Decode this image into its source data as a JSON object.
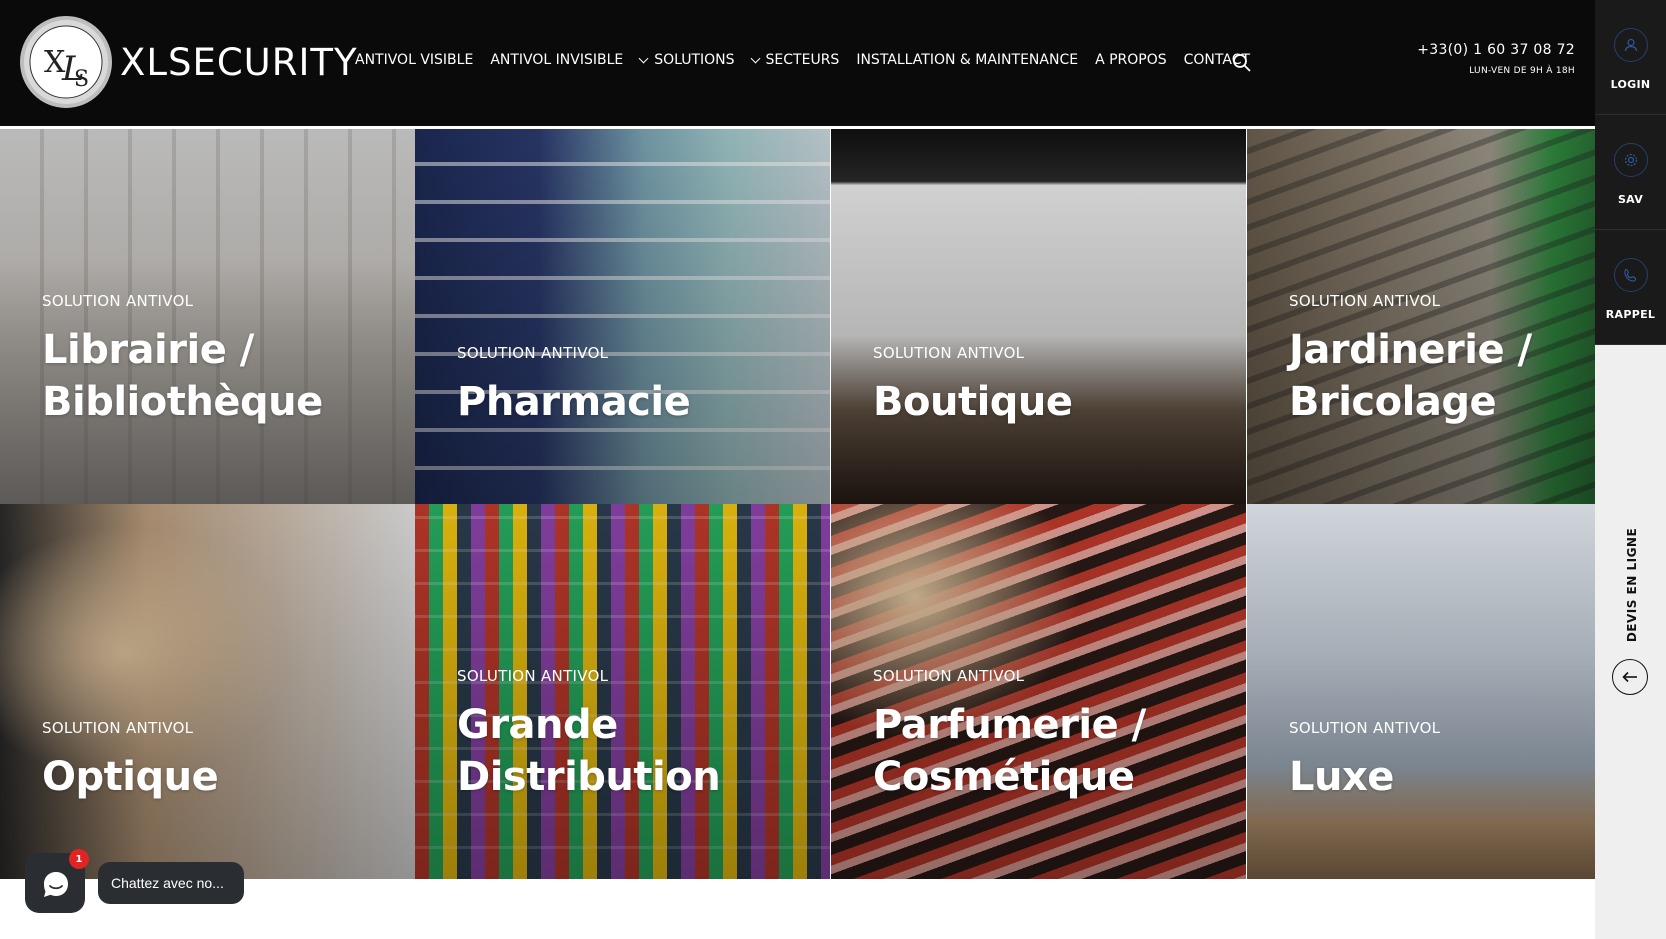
{
  "brand": {
    "name": "XLSECURITY",
    "monogram": "XLS"
  },
  "nav": {
    "items": [
      {
        "label": "ANTIVOL VISIBLE",
        "dropdown": false
      },
      {
        "label": "ANTIVOL INVISIBLE",
        "dropdown": false
      },
      {
        "label": "SOLUTIONS",
        "dropdown": true
      },
      {
        "label": "SECTEURS",
        "dropdown": true
      },
      {
        "label": "INSTALLATION & MAINTENANCE",
        "dropdown": false
      },
      {
        "label": "A PROPOS",
        "dropdown": false
      },
      {
        "label": "CONTACT",
        "dropdown": false
      }
    ],
    "search_icon": "search-icon"
  },
  "contact": {
    "phone": "+33(0) 1 60 37 08 72",
    "hours": "LUN-VEN DE 9H À 18H"
  },
  "sidebar": {
    "buttons": [
      {
        "label": "LOGIN",
        "icon": "user-icon"
      },
      {
        "label": "SAV",
        "icon": "gear-icon"
      },
      {
        "label": "RAPPEL",
        "icon": "phone-icon"
      }
    ],
    "devis_label": "DEVIS EN LIGNE",
    "toggle_icon": "arrow-left-icon"
  },
  "tiles": [
    {
      "kicker": "SOLUTION ANTIVOL",
      "title_lines": [
        "Librairie /",
        "Bibliothèque"
      ]
    },
    {
      "kicker": "SOLUTION ANTIVOL",
      "title_lines": [
        "Pharmacie"
      ]
    },
    {
      "kicker": "SOLUTION ANTIVOL",
      "title_lines": [
        "Boutique"
      ]
    },
    {
      "kicker": "SOLUTION ANTIVOL",
      "title_lines": [
        "Jardinerie /",
        "Bricolage"
      ]
    },
    {
      "kicker": "SOLUTION ANTIVOL",
      "title_lines": [
        "Optique"
      ]
    },
    {
      "kicker": "SOLUTION ANTIVOL",
      "title_lines": [
        "Grande",
        "Distribution"
      ]
    },
    {
      "kicker": "SOLUTION ANTIVOL",
      "title_lines": [
        "Parfumerie /",
        "Cosmétique"
      ]
    },
    {
      "kicker": "SOLUTION ANTIVOL",
      "title_lines": [
        "Luxe"
      ]
    }
  ],
  "chat": {
    "badge": "1",
    "label": "Chattez avec no...",
    "icon": "chat-icon"
  }
}
